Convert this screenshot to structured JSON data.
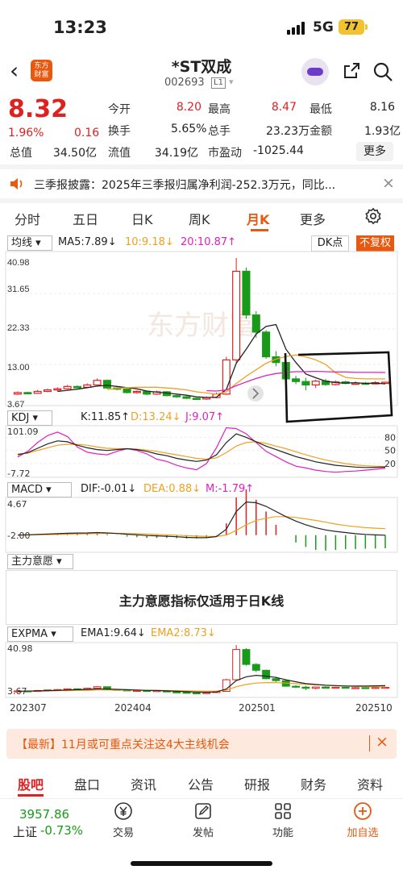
{
  "status_bar": {
    "time": "13:23",
    "network": "5G",
    "battery": "77"
  },
  "header": {
    "logo_line1": "东方",
    "logo_line2": "财富",
    "title": "*ST双成",
    "code": "002693",
    "level": "L1"
  },
  "quote": {
    "price": "8.32",
    "change_pct": "1.96%",
    "change": "0.16",
    "fields": [
      {
        "label": "今开",
        "value": "8.20",
        "red": true
      },
      {
        "label": "最高",
        "value": "8.47",
        "red": true
      },
      {
        "label": "最低",
        "value": "8.16",
        "red": false
      },
      {
        "label": "换手",
        "value": "5.65%",
        "red": false
      },
      {
        "label": "总手",
        "value": "23.23万",
        "red": false
      },
      {
        "label": "金额",
        "value": "1.93亿",
        "red": false
      },
      {
        "label": "总值",
        "value": "34.50亿",
        "red": false
      },
      {
        "label": "流值",
        "value": "34.19亿",
        "red": false
      },
      {
        "label": "市盈动",
        "value": "-1025.44",
        "red": false
      }
    ],
    "more_label": "更多"
  },
  "notice": {
    "text": "三季报披露：2025年三季报归属净利润-252.3万元，同比..."
  },
  "period_tabs": [
    "分时",
    "五日",
    "日K",
    "周K",
    "月K",
    "更多"
  ],
  "active_tab": "月K",
  "kline": {
    "selector": "均线",
    "ma5": "MA5:7.89↓",
    "ma10": "10:9.18↓",
    "ma20": "20:10.87↑",
    "dk_label": "DK点",
    "fq_label": "不复权",
    "y_labels": [
      "40.98",
      "31.65",
      "22.33",
      "13.00",
      "3.67"
    ],
    "watermark": "东方财富"
  },
  "kdj": {
    "selector": "KDJ",
    "k": "K:11.85↑",
    "d": "D:13.24↓",
    "j": "J:9.07↑",
    "y_top": "101.09",
    "y_bottom": "-7.72",
    "levels": [
      "80",
      "50",
      "20"
    ]
  },
  "macd": {
    "selector": "MACD",
    "dif": "DIF:-0.01↓",
    "dea": "DEA:0.88↓",
    "m": "M:-1.79↑",
    "y_top": "4.67",
    "y_bottom": "-2.00"
  },
  "zlyy": {
    "selector": "主力意愿",
    "message": "主力意愿指标仅适用于日K线"
  },
  "expma": {
    "selector": "EXPMA",
    "ema1": "EMA1:9.64↓",
    "ema2": "EMA2:8.73↓",
    "y_top": "40.98",
    "y_bottom": "3.67"
  },
  "x_labels": [
    "202307",
    "202404",
    "202501",
    "202510"
  ],
  "ad": {
    "text": "【最新】11月或可重点关注这4大主线机会"
  },
  "info_tabs": [
    "股吧",
    "盘口",
    "资讯",
    "公告",
    "研报",
    "财务",
    "资料"
  ],
  "bottom_nav": {
    "index_value": "3957.86",
    "index_name": "上证",
    "index_change": "-0.73%",
    "items": [
      {
        "label": "交易",
        "icon": "yen-icon"
      },
      {
        "label": "发帖",
        "icon": "edit-icon"
      },
      {
        "label": "功能",
        "icon": "grid-icon"
      },
      {
        "label": "加自选",
        "icon": "plus-icon"
      }
    ]
  },
  "colors": {
    "up": "#e02020",
    "down": "#1a9a1a",
    "accent": "#e8580e",
    "ma5": "#222222",
    "ma10": "#f0a020",
    "ma20": "#e020c0"
  },
  "chart_data": {
    "type": "candlestick",
    "candles": [
      {
        "o": 5.2,
        "c": 5.6,
        "h": 5.9,
        "l": 5.0
      },
      {
        "o": 5.6,
        "c": 5.4,
        "h": 5.8,
        "l": 5.2
      },
      {
        "o": 5.4,
        "c": 5.9,
        "h": 6.3,
        "l": 5.3
      },
      {
        "o": 5.9,
        "c": 6.3,
        "h": 6.6,
        "l": 5.7
      },
      {
        "o": 6.3,
        "c": 6.6,
        "h": 7.0,
        "l": 6.0
      },
      {
        "o": 6.6,
        "c": 7.2,
        "h": 7.6,
        "l": 6.4
      },
      {
        "o": 7.2,
        "c": 7.0,
        "h": 7.5,
        "l": 6.8
      },
      {
        "o": 7.0,
        "c": 7.6,
        "h": 8.0,
        "l": 6.9
      },
      {
        "o": 7.6,
        "c": 8.8,
        "h": 9.3,
        "l": 7.4
      },
      {
        "o": 8.8,
        "c": 6.8,
        "h": 9.0,
        "l": 6.6
      },
      {
        "o": 6.8,
        "c": 6.5,
        "h": 7.0,
        "l": 6.2
      },
      {
        "o": 6.5,
        "c": 5.6,
        "h": 6.8,
        "l": 5.4
      },
      {
        "o": 5.6,
        "c": 5.9,
        "h": 6.2,
        "l": 5.3
      },
      {
        "o": 5.9,
        "c": 5.2,
        "h": 6.0,
        "l": 4.9
      },
      {
        "o": 5.2,
        "c": 5.8,
        "h": 6.1,
        "l": 5.0
      },
      {
        "o": 5.8,
        "c": 4.8,
        "h": 6.0,
        "l": 4.6
      },
      {
        "o": 4.8,
        "c": 4.5,
        "h": 5.0,
        "l": 4.2
      },
      {
        "o": 4.5,
        "c": 4.1,
        "h": 4.7,
        "l": 3.9
      },
      {
        "o": 4.1,
        "c": 3.9,
        "h": 4.3,
        "l": 3.7
      },
      {
        "o": 3.9,
        "c": 4.3,
        "h": 4.6,
        "l": 3.7
      },
      {
        "o": 4.3,
        "c": 5.2,
        "h": 5.6,
        "l": 4.1
      },
      {
        "o": 5.2,
        "c": 14.2,
        "h": 15.0,
        "l": 5.0
      },
      {
        "o": 14.2,
        "c": 37.5,
        "h": 40.98,
        "l": 13.5
      },
      {
        "o": 37.5,
        "c": 26.0,
        "h": 38.5,
        "l": 25.0
      },
      {
        "o": 26.0,
        "c": 21.5,
        "h": 27.0,
        "l": 20.0
      },
      {
        "o": 21.5,
        "c": 15.0,
        "h": 22.0,
        "l": 14.5
      },
      {
        "o": 15.0,
        "c": 13.5,
        "h": 16.5,
        "l": 12.5
      },
      {
        "o": 13.5,
        "c": 9.2,
        "h": 14.0,
        "l": 8.8
      },
      {
        "o": 9.2,
        "c": 8.5,
        "h": 10.0,
        "l": 7.8
      },
      {
        "o": 8.5,
        "c": 7.6,
        "h": 9.5,
        "l": 6.2
      },
      {
        "o": 7.6,
        "c": 8.6,
        "h": 9.0,
        "l": 6.8
      },
      {
        "o": 8.6,
        "c": 7.7,
        "h": 9.2,
        "l": 7.4
      },
      {
        "o": 7.7,
        "c": 8.4,
        "h": 8.8,
        "l": 7.5
      },
      {
        "o": 8.4,
        "c": 8.0,
        "h": 8.7,
        "l": 7.8
      },
      {
        "o": 8.0,
        "c": 8.1,
        "h": 8.5,
        "l": 7.8
      },
      {
        "o": 8.1,
        "c": 7.9,
        "h": 8.4,
        "l": 7.7
      },
      {
        "o": 7.9,
        "c": 8.2,
        "h": 8.6,
        "l": 7.8
      },
      {
        "o": 8.2,
        "c": 8.32,
        "h": 8.47,
        "l": 8.16
      }
    ],
    "ma5": [
      null,
      null,
      null,
      null,
      5.9,
      6.2,
      6.5,
      6.9,
      7.3,
      7.5,
      7.2,
      6.9,
      6.6,
      6.0,
      5.7,
      5.5,
      5.2,
      4.9,
      4.5,
      4.3,
      4.4,
      6.4,
      13.3,
      17.0,
      21.0,
      23.0,
      23.5,
      17.0,
      13.5,
      10.5,
      9.5,
      8.6,
      8.2,
      8.1,
      8.2,
      8.0,
      8.1,
      7.89
    ],
    "ma10": [
      null,
      null,
      null,
      null,
      null,
      null,
      null,
      null,
      null,
      6.4,
      6.7,
      6.9,
      7.0,
      7.0,
      7.0,
      6.8,
      6.6,
      6.3,
      5.8,
      5.5,
      5.2,
      5.8,
      8.0,
      9.9,
      11.6,
      13.3,
      14.4,
      15.1,
      15.5,
      15.0,
      14.2,
      13.0,
      10.8,
      9.6,
      9.3,
      9.2,
      9.2,
      9.18
    ],
    "ma20": [
      null,
      null,
      null,
      null,
      null,
      null,
      null,
      null,
      null,
      null,
      null,
      null,
      null,
      null,
      null,
      null,
      null,
      null,
      null,
      6.1,
      6.0,
      6.3,
      7.4,
      8.4,
      9.3,
      10.1,
      10.6,
      10.9,
      11.1,
      11.1,
      11.2,
      11.1,
      11.0,
      11.0,
      10.9,
      10.9,
      10.9,
      10.87
    ],
    "kdj_k": [
      40,
      45,
      55,
      65,
      72,
      70,
      62,
      56,
      52,
      50,
      52,
      54,
      52,
      48,
      42,
      38,
      32,
      28,
      25,
      28,
      40,
      68,
      88,
      80,
      70,
      60,
      52,
      44,
      36,
      30,
      24,
      20,
      16,
      14,
      12,
      11,
      11.5,
      11.85
    ],
    "kdj_d": [
      42,
      44,
      50,
      56,
      62,
      64,
      64,
      62,
      58,
      55,
      54,
      54,
      53,
      51,
      48,
      44,
      40,
      36,
      32,
      30,
      33,
      45,
      60,
      68,
      70,
      66,
      60,
      54,
      47,
      40,
      34,
      28,
      24,
      20,
      17,
      15,
      14,
      13.24
    ],
    "kdj_j": [
      35,
      48,
      68,
      84,
      92,
      82,
      58,
      46,
      42,
      40,
      48,
      54,
      50,
      42,
      30,
      25,
      16,
      10,
      6,
      20,
      56,
      102,
      100,
      88,
      68,
      48,
      36,
      24,
      14,
      10,
      5,
      2,
      0,
      2,
      3,
      5,
      7,
      9.07
    ],
    "macd_dif": [
      0,
      0.05,
      0.1,
      0.15,
      0.2,
      0.25,
      0.28,
      0.3,
      0.35,
      0.3,
      0.22,
      0.12,
      0.05,
      -0.05,
      -0.1,
      -0.15,
      -0.22,
      -0.3,
      -0.35,
      -0.35,
      -0.2,
      0.8,
      3.2,
      4.5,
      4.4,
      3.9,
      3.2,
      2.5,
      1.9,
      1.4,
      1.0,
      0.7,
      0.5,
      0.35,
      0.2,
      0.1,
      0.03,
      -0.01
    ],
    "macd_dea": [
      0,
      0.02,
      0.04,
      0.07,
      0.1,
      0.13,
      0.16,
      0.19,
      0.22,
      0.24,
      0.24,
      0.22,
      0.19,
      0.14,
      0.09,
      0.04,
      -0.01,
      -0.07,
      -0.13,
      -0.17,
      -0.18,
      0.0,
      0.65,
      1.4,
      2.0,
      2.3,
      2.5,
      2.5,
      2.4,
      2.2,
      2.0,
      1.75,
      1.5,
      1.3,
      1.15,
      1.02,
      0.94,
      0.88
    ],
    "macd_m": [
      0,
      0.06,
      0.12,
      0.16,
      0.2,
      0.24,
      0.24,
      0.22,
      0.26,
      0.12,
      -0.04,
      -0.2,
      -0.28,
      -0.38,
      -0.38,
      -0.38,
      -0.42,
      -0.46,
      -0.44,
      -0.36,
      -0.04,
      1.6,
      5.1,
      6.2,
      4.8,
      3.2,
      1.4,
      0,
      -1.0,
      -1.6,
      -2.0,
      -2.1,
      -2.0,
      -1.9,
      -1.9,
      -1.84,
      -1.82,
      -1.79
    ],
    "ema1": [
      5.3,
      5.4,
      5.6,
      5.8,
      6.0,
      6.3,
      6.5,
      6.7,
      7.1,
      7.0,
      6.8,
      6.5,
      6.3,
      6.0,
      5.9,
      5.6,
      5.3,
      5.0,
      4.7,
      4.6,
      4.8,
      7.0,
      13.5,
      16.5,
      17.6,
      17.0,
      16.0,
      14.2,
      12.6,
      11.2,
      10.6,
      10.0,
      9.7,
      9.4,
      9.3,
      9.4,
      9.5,
      9.64
    ],
    "ema2": [
      5.3,
      5.35,
      5.45,
      5.55,
      5.7,
      5.85,
      6.0,
      6.1,
      6.3,
      6.3,
      6.3,
      6.2,
      6.2,
      6.1,
      6.0,
      5.9,
      5.8,
      5.6,
      5.5,
      5.4,
      5.4,
      6.2,
      8.8,
      10.6,
      11.6,
      12.0,
      12.0,
      11.6,
      11.2,
      10.7,
      10.3,
      9.9,
      9.6,
      9.3,
      9.1,
      8.9,
      8.8,
      8.73
    ],
    "ylim": [
      3.67,
      40.98
    ],
    "x_ticks": [
      "202307",
      "202404",
      "202501",
      "202510"
    ]
  }
}
